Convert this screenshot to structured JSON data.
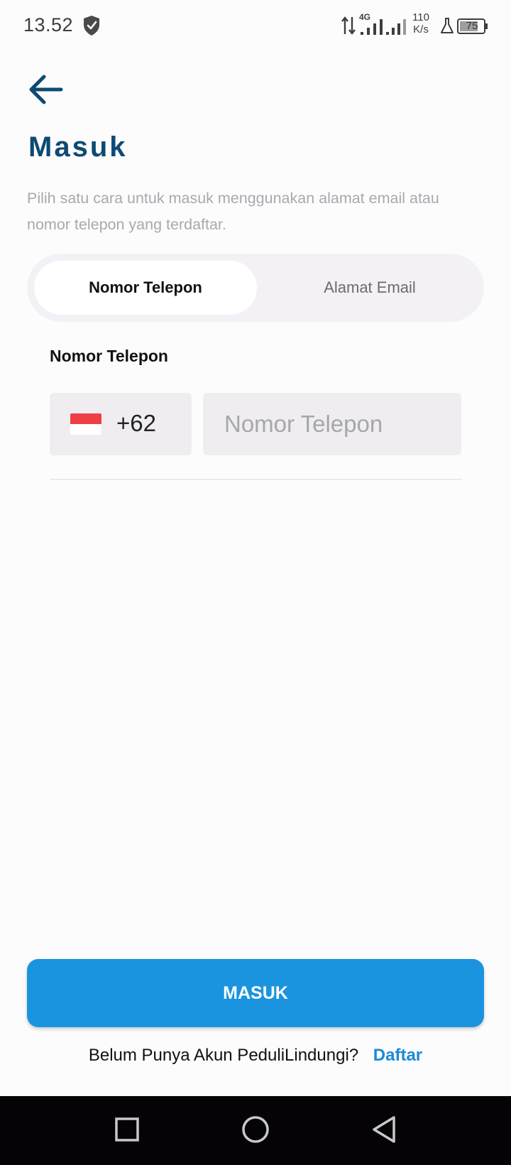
{
  "status_bar": {
    "time": "13.52",
    "network": "4G",
    "speed_value": "110",
    "speed_unit": "K/s",
    "battery": "75",
    "icons": [
      "shield-icon",
      "data-arrows-icon",
      "signal-icon",
      "signal-icon",
      "flask-icon",
      "battery-icon"
    ]
  },
  "header": {
    "back_icon": "arrow-left-icon",
    "title": "Masuk",
    "subtitle": "Pilih satu cara untuk masuk menggunakan alamat email atau nomor telepon yang terdaftar."
  },
  "tabs": [
    {
      "label": "Nomor Telepon",
      "active": true
    },
    {
      "label": "Alamat Email",
      "active": false
    }
  ],
  "form": {
    "field_label": "Nomor Telepon",
    "country_flag": "indonesia-flag",
    "country_code": "+62",
    "phone_value": "",
    "phone_placeholder": "Nomor Telepon"
  },
  "footer": {
    "submit_label": "MASUK",
    "register_prompt": "Belum Punya Akun PeduliLindungi?",
    "register_link": "Daftar"
  },
  "nav_bar": {
    "buttons": [
      "recent-apps-icon",
      "home-icon",
      "back-icon"
    ]
  },
  "colors": {
    "title": "#0d4a74",
    "primary": "#1b94e0",
    "link": "#1b8ad6",
    "subtitle": "#a8a8ae",
    "field_bg": "#efedf0",
    "tab_bg": "#f3f1f5"
  }
}
